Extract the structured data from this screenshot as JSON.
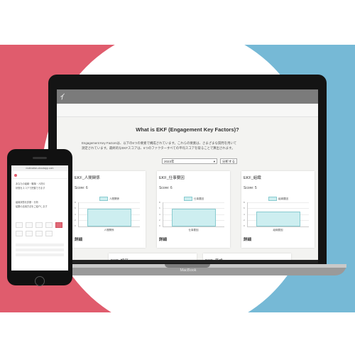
{
  "app": {
    "logo_glyph": "ｲ",
    "page_title": "What is EKF (Engagement Key Factors)?",
    "intro_line1": "Engagement Key Factorsは、以下の6つの要素で構成されています。これらの要素は、さまざまな質問を用いて",
    "intro_line2": "測定されています。最終的なEKFスコアは、6つのファクターすべての平均スコアを取ることで算出されます。",
    "year_select": "2023年",
    "year_caret": "▾",
    "analyze_button": "分析する"
  },
  "cards": [
    {
      "title": "EKF_人間関係",
      "score": "Score: 6",
      "legend": "人間関係",
      "xlabel": "人間関係",
      "value": 6,
      "detail": "詳細"
    },
    {
      "title": "EKF_仕事要因",
      "score": "Score: 6",
      "legend": "仕事要因",
      "xlabel": "仕事要因",
      "value": 6,
      "detail": "詳細"
    },
    {
      "title": "EKF_組織",
      "score": "Score: 5",
      "legend": "組織要因",
      "xlabel": "組織要因",
      "value": 5,
      "detail": "詳細"
    }
  ],
  "bottom_cards": [
    {
      "title": "EKF_評価"
    },
    {
      "title": "EKF_育成"
    }
  ],
  "y_ticks": [
    "8",
    "6",
    "4",
    "2",
    "0"
  ],
  "y_max": 8,
  "laptop": {
    "brand": "MacBook"
  },
  "phone": {
    "url": "motivation-cloudapp.com",
    "text1": "あなたの組織・職場・人材の",
    "text2": "状態をスコアで把握できます",
    "text3": "組織状態を診断・分析",
    "text4": "結果の活用方法をご紹介します"
  },
  "colors": {
    "accent_red": "#e05c6d",
    "accent_blue": "#76b9d6",
    "bar_fill": "#cdeef0",
    "bar_stroke": "#89cbd0"
  }
}
